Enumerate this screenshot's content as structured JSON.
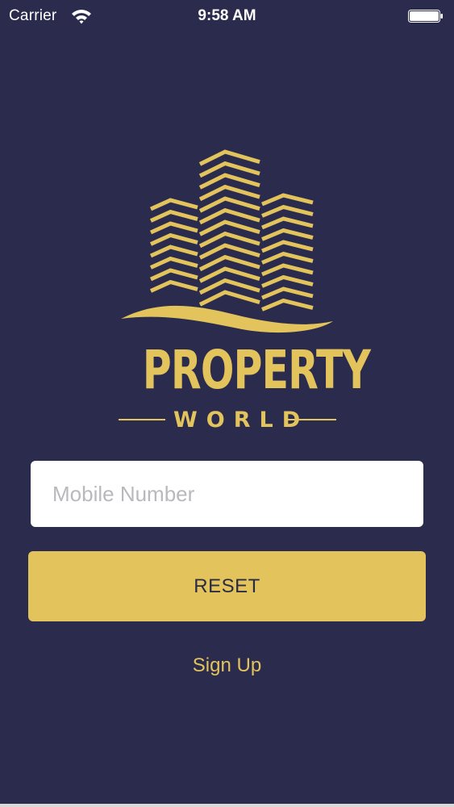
{
  "status_bar": {
    "carrier": "Carrier",
    "time": "9:58 AM",
    "wifi_icon": "wifi-icon",
    "battery_icon": "battery-icon"
  },
  "brand": {
    "logo_icon": "buildings-logo-icon",
    "title": "PROPERTY",
    "subtitle": "WORLD",
    "color": "#e2c35c"
  },
  "form": {
    "mobile_placeholder": "Mobile Number",
    "mobile_value": "",
    "reset_label": "RESET",
    "signup_label": "Sign Up"
  },
  "theme": {
    "background": "#2b2b4d",
    "accent": "#e2c35c",
    "input_background": "#ffffff"
  }
}
